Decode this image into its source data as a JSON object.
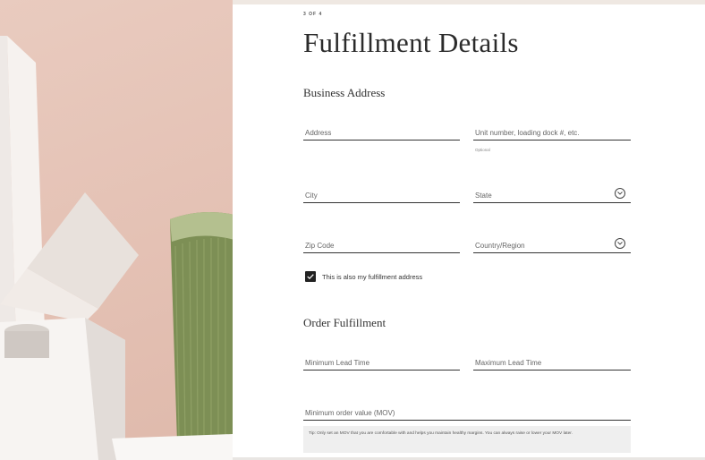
{
  "step_indicator": "3 OF 4",
  "title": "Fulfillment Details",
  "sections": {
    "business_address": "Business Address",
    "order_fulfillment": "Order Fulfillment"
  },
  "fields": {
    "address": "Address",
    "unit": "Unit number, loading dock #, etc.",
    "unit_hint": "Optional",
    "city": "City",
    "state": "State",
    "zip": "Zip Code",
    "country": "Country/Region",
    "min_lead_time": "Minimum Lead Time",
    "max_lead_time": "Maximum Lead Time",
    "mov": "Minimum order value (MOV)"
  },
  "checkbox": {
    "label": "This is also my fulfillment address",
    "checked": true
  },
  "tip": "Tip: Only set an MOV that you are comfortable with and helps you maintain healthy margins. You can always raise or lower your MOV later.",
  "icons": [
    "chevron-down-icon",
    "checkmark-icon"
  ],
  "colors": {
    "accent": "#222222",
    "photo_background": "#e6c5b8",
    "tip_background": "#efefef"
  }
}
